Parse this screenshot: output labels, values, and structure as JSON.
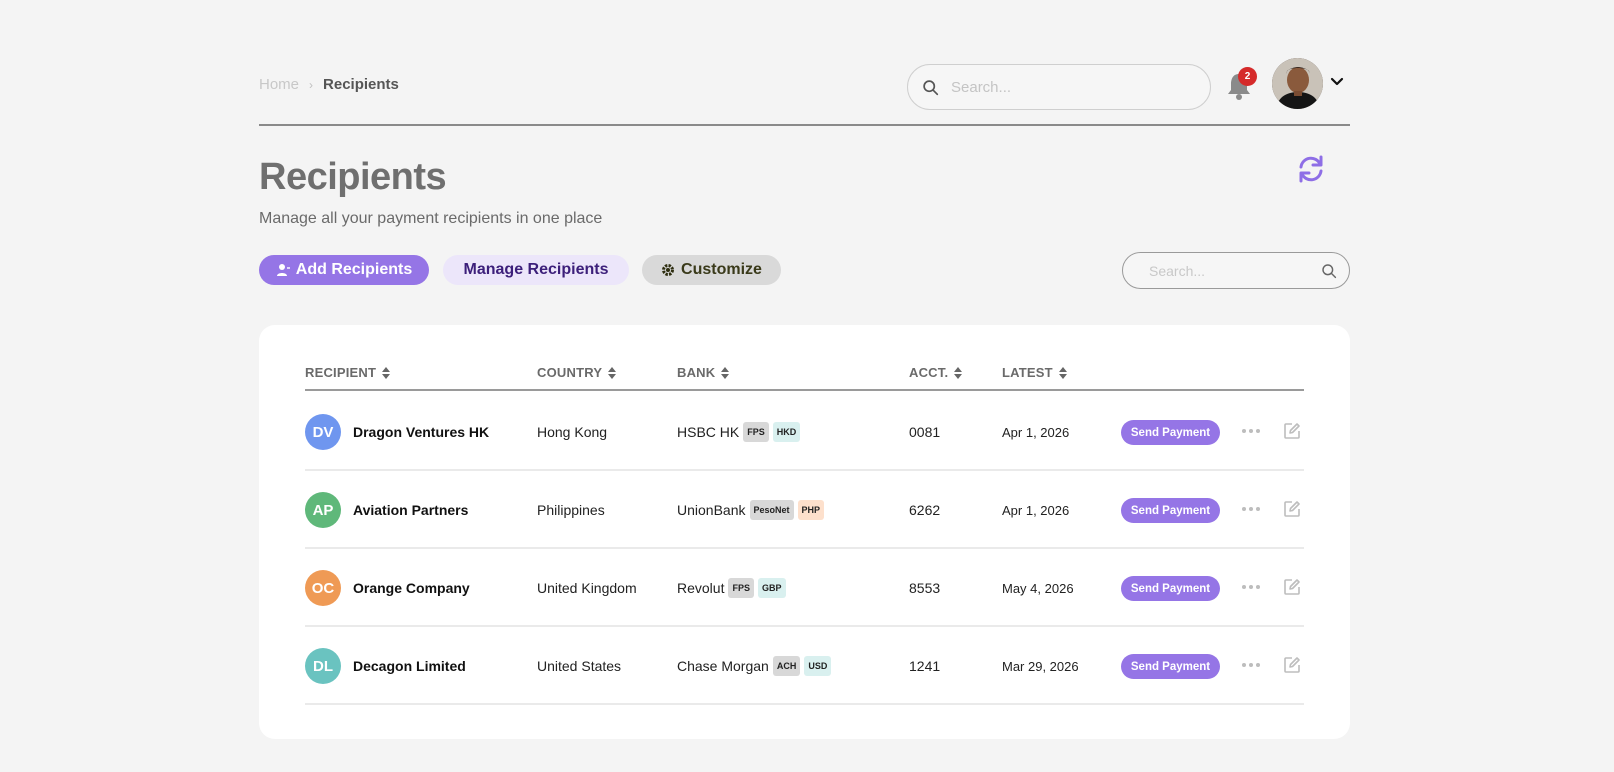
{
  "breadcrumb": {
    "home": "Home",
    "separator": "›",
    "current": "Recipients"
  },
  "top_search": {
    "placeholder": "Search..."
  },
  "notifications": {
    "count": "2"
  },
  "header": {
    "title": "Recipients",
    "subtitle": "Manage all your payment recipients in one place"
  },
  "actions": {
    "add_label": "Add Recipients",
    "manage_label": "Manage Recipients",
    "customize_label": "Customize"
  },
  "table_search": {
    "placeholder": "Search..."
  },
  "columns": [
    "RECIPIENT",
    "COUNTRY",
    "BANK",
    "ACCT.",
    "LATEST"
  ],
  "rows": [
    {
      "initials": "DV",
      "color": "#6f96ef",
      "name": "Dragon Ventures HK",
      "country": "Hong Kong",
      "bank": "HSBC HK",
      "network": "FPS",
      "currency": "HKD",
      "acct": "0081",
      "latest": "Apr 1, 2026",
      "action": "Send Payment"
    },
    {
      "initials": "AP",
      "color": "#5fb87a",
      "name": "Aviation Partners",
      "country": "Philippines",
      "bank": "UnionBank",
      "network": "PesoNet",
      "currency": "PHP",
      "acct": "6262",
      "latest": "Apr 1, 2026",
      "action": "Send Payment"
    },
    {
      "initials": "OC",
      "color": "#ef9a55",
      "name": "Orange Company",
      "country": "United Kingdom",
      "bank": "Revolut",
      "network": "FPS",
      "currency": "GBP",
      "acct": "8553",
      "latest": "May 4, 2026",
      "action": "Send Payment"
    },
    {
      "initials": "DL",
      "color": "#6ac3c0",
      "name": "Decagon Limited",
      "country": "United States",
      "bank": "Chase Morgan",
      "network": "ACH",
      "currency": "USD",
      "acct": "1241",
      "latest": "Mar 29, 2026",
      "action": "Send Payment"
    }
  ],
  "colors": {
    "accent": "#9575e6",
    "badge": "#d52a2a"
  },
  "icons": [
    "search-icon",
    "bell-icon",
    "chevron-down-icon",
    "refresh-icon",
    "add-user-icon",
    "gear-icon",
    "sort-icon",
    "more-icon",
    "edit-icon"
  ]
}
